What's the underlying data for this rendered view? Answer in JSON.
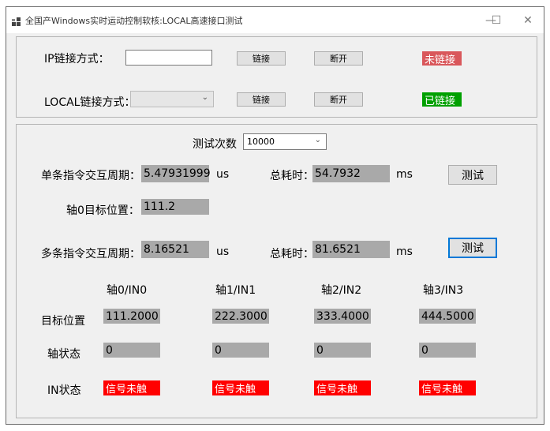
{
  "window": {
    "title": "全国产Windows实时运动控制软核:LOCAL高速接口测试",
    "minimize": "—",
    "maximize": "☐",
    "close": "✕"
  },
  "connection": {
    "ip_label": "IP链接方式：",
    "ip_value": "",
    "local_label": "LOCAL链接方式：",
    "local_value": "",
    "connect_label": "链接",
    "disconnect_label": "断开",
    "ip_status": "未链接",
    "local_status": "已链接",
    "colors": {
      "not_linked": "#d9575b",
      "linked": "#00a000"
    }
  },
  "test": {
    "count_label": "测试次数",
    "count_value": "10000",
    "single_label": "单条指令交互周期：",
    "single_value": "5.47931999",
    "single_unit": "us",
    "total_label": "总耗时：",
    "single_total": "54.7932",
    "total_unit": "ms",
    "test_button": "测试",
    "axis0_target_label": "轴0目标位置：",
    "axis0_target_value": "111.2",
    "multi_label": "多条指令交互周期：",
    "multi_value": "8.16521",
    "multi_unit": "us",
    "multi_total": "81.6521"
  },
  "axes": {
    "headers": [
      "轴0/IN0",
      "轴1/IN1",
      "轴2/IN2",
      "轴3/IN3"
    ],
    "row_labels": {
      "target": "目标位置",
      "state": "轴状态",
      "in": "IN状态"
    },
    "target": [
      "111.2000",
      "222.3000",
      "333.4000",
      "444.5000"
    ],
    "state": [
      "0",
      "0",
      "0",
      "0"
    ],
    "in_state": [
      "信号未触",
      "信号未触",
      "信号未触",
      "信号未触"
    ],
    "colors": {
      "signal_off": "#ff0000",
      "value_bg": "#a9a9a9"
    }
  }
}
